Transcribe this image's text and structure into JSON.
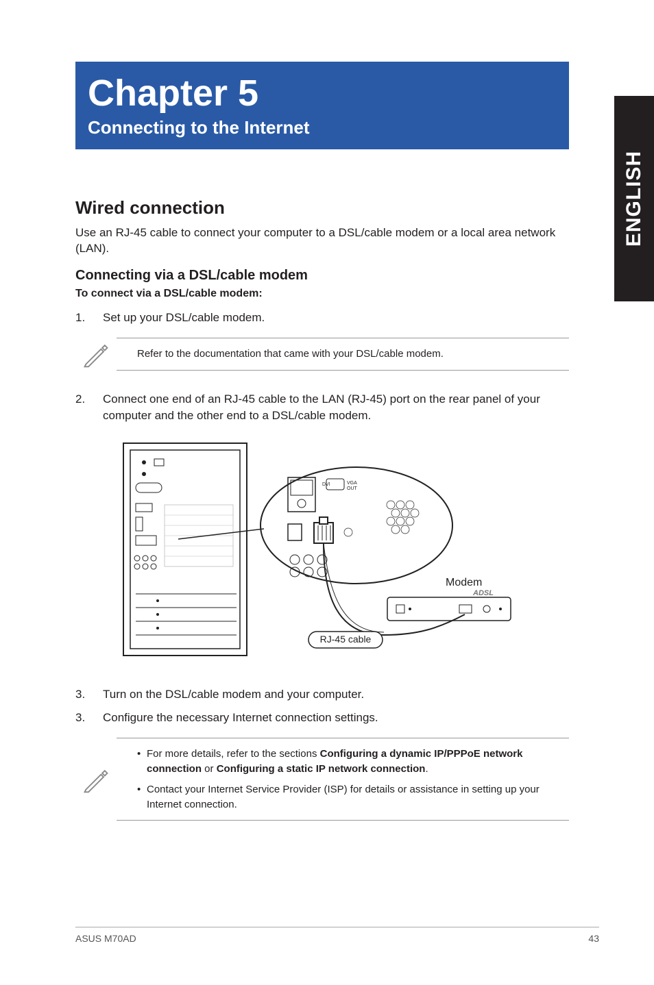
{
  "side_tab": "ENGLISH",
  "banner": {
    "title": "Chapter 5",
    "subtitle": "Connecting to the Internet"
  },
  "section_heading": "Wired connection",
  "intro": "Use an RJ-45 cable to connect your computer to a DSL/cable modem or a local area network (LAN).",
  "subsection_heading": "Connecting via a DSL/cable modem",
  "lead": "To connect via a DSL/cable modem:",
  "steps_a": [
    {
      "n": "1.",
      "t": "Set up your DSL/cable modem."
    }
  ],
  "note1": "Refer to the documentation that came with your DSL/cable modem.",
  "steps_b": [
    {
      "n": "2.",
      "t": "Connect one end of an RJ-45 cable to the LAN (RJ-45) port on the rear panel of your computer and the other end to a DSL/cable modem."
    }
  ],
  "diagram": {
    "modem_label": "Modem",
    "cable_label": "RJ-45 cable",
    "brand": "ADSL"
  },
  "steps_c": [
    {
      "n": "3.",
      "t": "Turn on the DSL/cable modem and your computer."
    },
    {
      "n": "3.",
      "t": "Configure the necessary Internet connection settings."
    }
  ],
  "note2": {
    "bullet1_pre": "For more details, refer to the sections ",
    "bullet1_b1": "Configuring a dynamic IP/PPPoE network connection",
    "bullet1_mid": " or ",
    "bullet1_b2": "Configuring a static IP network connection",
    "bullet1_suffix": ".",
    "bullet2": "Contact your Internet Service Provider (ISP) for details or assistance in setting up your Internet connection."
  },
  "footer": {
    "left": "ASUS M70AD",
    "right": "43"
  }
}
